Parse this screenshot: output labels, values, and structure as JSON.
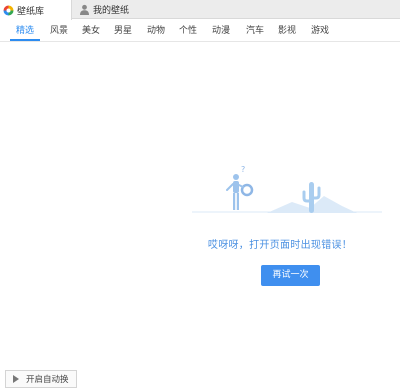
{
  "tabs": [
    {
      "label": "壁纸库",
      "icon": "pinwheel-logo-icon",
      "active": true
    },
    {
      "label": "我的壁纸",
      "icon": "user-icon",
      "active": false
    }
  ],
  "categories": [
    "精选",
    "风景",
    "美女",
    "男星",
    "动物",
    "个性",
    "动漫",
    "汽车",
    "影视",
    "游戏"
  ],
  "active_category": "精选",
  "error": {
    "message": "哎呀呀，打开页面时出现错误！",
    "retry_label": "再试一次"
  },
  "footer": {
    "auto_switch_label": "开启自动换",
    "icon": "play-icon"
  },
  "colors": {
    "accent": "#2d8cf0",
    "button": "#3f8fef",
    "illustration": "#b9d7f3"
  }
}
